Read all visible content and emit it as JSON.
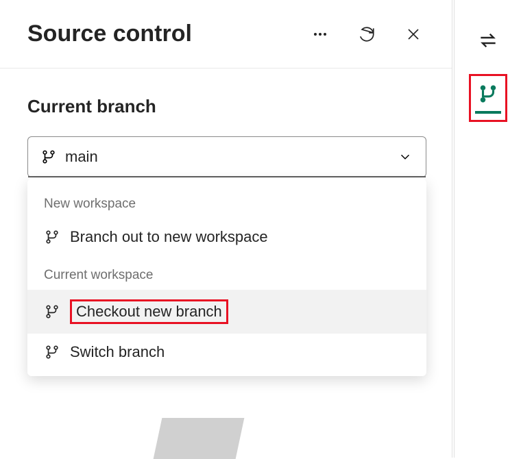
{
  "header": {
    "title": "Source control"
  },
  "section": {
    "label": "Current branch"
  },
  "dropdown": {
    "selected_value": "main",
    "groups": [
      {
        "label": "New workspace",
        "items": [
          {
            "label": "Branch out to new workspace",
            "highlighted": false,
            "redbox": false
          }
        ]
      },
      {
        "label": "Current workspace",
        "items": [
          {
            "label": "Checkout new branch",
            "highlighted": true,
            "redbox": true
          },
          {
            "label": "Switch branch",
            "highlighted": false,
            "redbox": false
          }
        ]
      }
    ]
  }
}
